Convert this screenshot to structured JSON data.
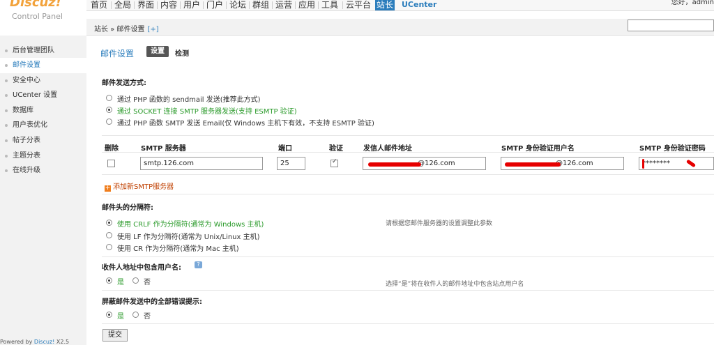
{
  "logo": {
    "brand": "Discuz!",
    "sub": "Control Panel"
  },
  "topnav": {
    "items": [
      "首页",
      "全局",
      "界面",
      "内容",
      "用户",
      "门户",
      "论坛",
      "群组",
      "运营",
      "应用",
      "工具",
      "云平台",
      "站长"
    ],
    "active": "站长",
    "ucenter": "UCenter",
    "right_text": "您好，admin"
  },
  "breadcrumb": {
    "text": "站长 » 邮件设置",
    "plus": "[+]"
  },
  "sidebar": {
    "items": [
      "后台管理团队",
      "邮件设置",
      "安全中心",
      "UCenter 设置",
      "数据库",
      "用户表优化",
      "帖子分表",
      "主题分表",
      "在线升级"
    ],
    "active_index": 1
  },
  "footer": {
    "prefix": "Powered by ",
    "brand": "Discuz!",
    "version": " X2.5"
  },
  "main": {
    "title": "邮件设置",
    "tab_set": "设置",
    "tab_test": "检测",
    "send_method": {
      "heading": "邮件发送方式:",
      "options": [
        "通过 PHP 函数的 sendmail 发送(推荐此方式)",
        "通过 SOCKET 连接 SMTP 服务器发送(支持 ESMTP 验证)",
        "通过 PHP 函数 SMTP 发送 Email(仅 Windows 主机下有效，不支持 ESMTP 验证)"
      ],
      "selected": 1
    },
    "smtp_table": {
      "headers": [
        "删除",
        "SMTP 服务器",
        "端口",
        "验证",
        "发信人邮件地址",
        "SMTP 身份验证用户名",
        "SMTP 身份验证密码"
      ],
      "row": {
        "delete": false,
        "server": "smtp.126.com",
        "port": "25",
        "auth": true,
        "from": "@126.com",
        "username": "@126.com",
        "password": "********"
      },
      "add_label": "添加新SMTP服务器"
    },
    "header_sep": {
      "heading": "邮件头的分隔符:",
      "options": [
        "使用 CRLF 作为分隔符(通常为 Windows 主机)",
        "使用 LF 作为分隔符(通常为 Unix/Linux 主机)",
        "使用 CR 作为分隔符(通常为 Mac 主机)"
      ],
      "selected": 0,
      "tip": "请根据您邮件服务器的设置调整此参数"
    },
    "include_username": {
      "heading": "收件人地址中包含用户名:",
      "yes": "是",
      "no": "否",
      "selected": "yes",
      "tip": "选择“是”将在收件人的邮件地址中包含站点用户名"
    },
    "suppress_errors": {
      "heading": "屏蔽邮件发送中的全部错误提示:",
      "yes": "是",
      "no": "否",
      "selected": "yes"
    },
    "submit_label": "提交"
  }
}
